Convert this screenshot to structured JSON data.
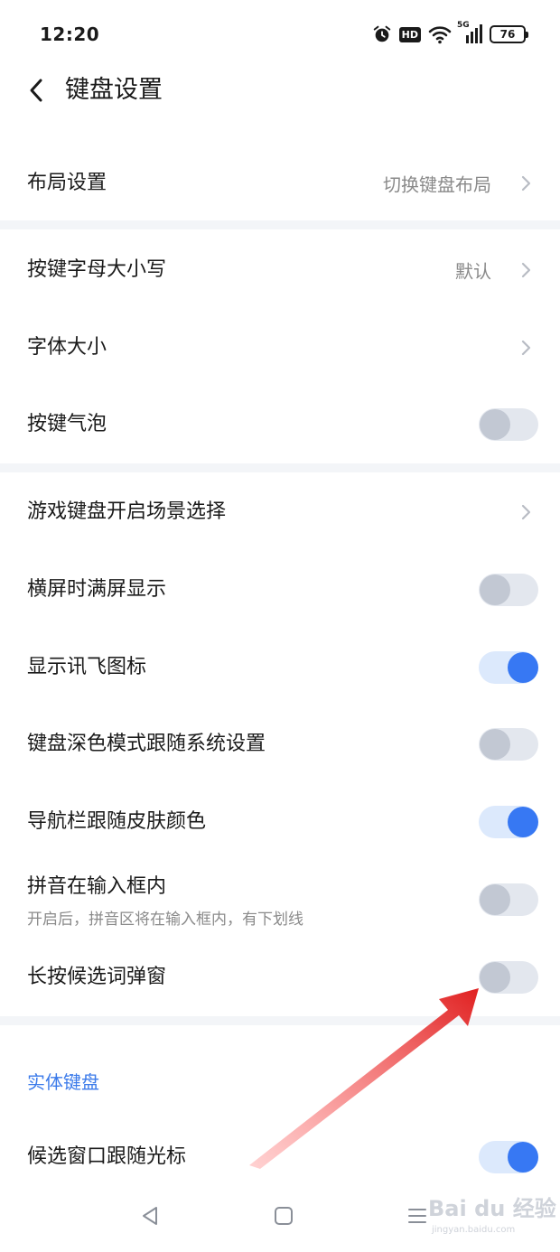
{
  "status_bar": {
    "time": "12:20",
    "hd": "HD",
    "network": "5G",
    "battery": "76"
  },
  "header": {
    "title": "键盘设置"
  },
  "rows": {
    "layout": {
      "label": "布局设置",
      "value": "切换键盘布局"
    },
    "key_case": {
      "label": "按键字母大小写",
      "value": "默认"
    },
    "font_size": {
      "label": "字体大小"
    },
    "key_bubble": {
      "label": "按键气泡",
      "state": "off"
    },
    "game_keyboard": {
      "label": "游戏键盘开启场景选择"
    },
    "landscape_full": {
      "label": "横屏时满屏显示",
      "state": "off"
    },
    "show_iflytek_icon": {
      "label": "显示讯飞图标",
      "state": "on"
    },
    "dark_mode_follow": {
      "label": "键盘深色模式跟随系统设置",
      "state": "off"
    },
    "nav_bar_skin": {
      "label": "导航栏跟随皮肤颜色",
      "state": "on"
    },
    "pinyin_in_input": {
      "label": "拼音在输入框内",
      "description": "开启后，拼音区将在输入框内，有下划线",
      "state": "off"
    },
    "long_press_popup": {
      "label": "长按候选词弹窗",
      "state": "off"
    },
    "candidate_follow_cursor": {
      "label": "候选窗口跟随光标",
      "state": "on"
    }
  },
  "section": {
    "physical_keyboard": "实体键盘"
  },
  "colors": {
    "accent": "#3778f3",
    "toggle_off_track": "#e3e7ee",
    "toggle_off_knob": "#c2c8d3",
    "annotation_arrow": "#e02020"
  },
  "watermark": {
    "brand": "Bai du 经验",
    "url": "jingyan.baidu.com"
  }
}
